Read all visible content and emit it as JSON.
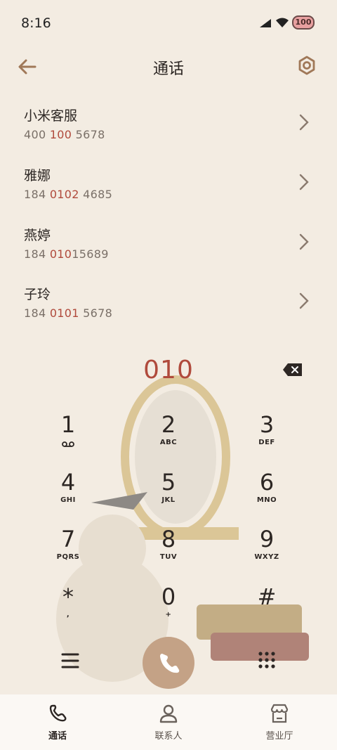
{
  "status_bar": {
    "time": "8:16",
    "battery": "100"
  },
  "header": {
    "title": "通话"
  },
  "suggestions": [
    {
      "name": "小米客服",
      "number_pre": "400 ",
      "number_match": "100",
      "number_post": " 5678"
    },
    {
      "name": "雅娜",
      "number_pre": "184 ",
      "number_match": "0102",
      "number_post": " 4685"
    },
    {
      "name": "燕婷",
      "number_pre": "184 ",
      "number_match": "010",
      "number_post": "15689"
    },
    {
      "name": "子玲",
      "number_pre": "184 ",
      "number_match": "0101",
      "number_post": " 5678"
    }
  ],
  "dialer": {
    "input_value": "010",
    "keys": [
      {
        "digit": "1",
        "letters": ""
      },
      {
        "digit": "2",
        "letters": "ABC"
      },
      {
        "digit": "3",
        "letters": "DEF"
      },
      {
        "digit": "4",
        "letters": "GHI"
      },
      {
        "digit": "5",
        "letters": "JKL"
      },
      {
        "digit": "6",
        "letters": "MNO"
      },
      {
        "digit": "7",
        "letters": "PQRS"
      },
      {
        "digit": "8",
        "letters": "TUV"
      },
      {
        "digit": "9",
        "letters": "WXYZ"
      },
      {
        "digit": "*",
        "letters": ","
      },
      {
        "digit": "0",
        "letters": "+"
      },
      {
        "digit": "#",
        "letters": ""
      }
    ]
  },
  "bottom_nav": {
    "tabs": [
      {
        "label": "通话",
        "icon": "phone-icon",
        "active": true
      },
      {
        "label": "联系人",
        "icon": "person-icon",
        "active": false
      },
      {
        "label": "营业厅",
        "icon": "store-icon",
        "active": false
      }
    ]
  },
  "colors": {
    "accent": "#b04a3c",
    "call_button": "#c4a286",
    "background": "#f3ece2"
  }
}
